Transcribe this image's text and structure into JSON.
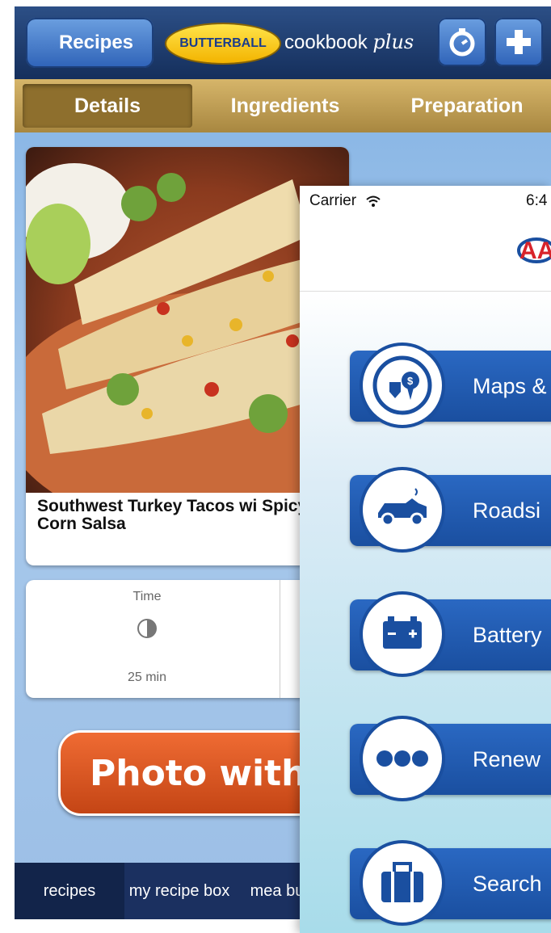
{
  "topbar": {
    "back_label": "Recipes",
    "logo_brand": "BUTTERBALL",
    "logo_suffix": "cookbook",
    "logo_script": "plus"
  },
  "tabs": [
    "Details",
    "Ingredients",
    "Preparation"
  ],
  "recipe": {
    "title": "Southwest Turkey Tacos wi Spicy Corn Salsa",
    "time_label": "Time",
    "time_value": "25 min"
  },
  "photo_button_label": "Photo with",
  "bottom_tabs": [
    "recipes",
    "my recipe box",
    "mea build"
  ],
  "overlay": {
    "carrier": "Carrier",
    "time": "6:4",
    "menu": [
      {
        "label": "Maps &",
        "icon": "map-pin-icon"
      },
      {
        "label": "Roadsi",
        "icon": "car-breakdown-icon"
      },
      {
        "label": "Battery",
        "icon": "battery-icon"
      },
      {
        "label": "Renew",
        "icon": "more-dots-icon"
      },
      {
        "label": "Search",
        "icon": "suitcase-icon"
      }
    ]
  },
  "colors": {
    "navy": "#1b3060",
    "accent_orange": "#e35a24",
    "aaa_blue": "#1a4fa0"
  }
}
